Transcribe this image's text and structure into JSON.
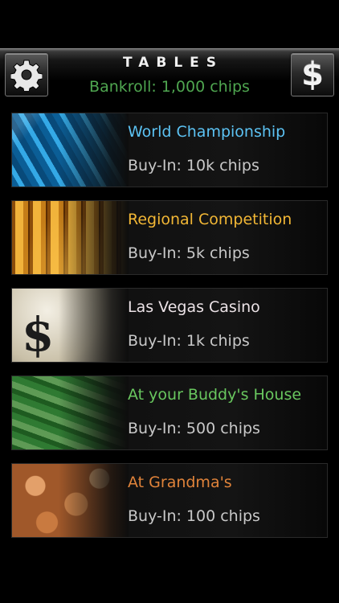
{
  "header": {
    "title": "TABLES",
    "bankroll": "Bankroll: 1,000 chips",
    "settings_icon": "gear-icon",
    "store_icon": "dollar-icon",
    "store_label": "$"
  },
  "tables": [
    {
      "name": "World Championship",
      "buyin": "Buy-In: 10k chips",
      "color": "#5cc3f4"
    },
    {
      "name": "Regional Competition",
      "buyin": "Buy-In: 5k chips",
      "color": "#f2b735"
    },
    {
      "name": "Las Vegas Casino",
      "buyin": "Buy-In: 1k chips",
      "color": "#ebe2e6"
    },
    {
      "name": "At your Buddy's House",
      "buyin": "Buy-In: 500 chips",
      "color": "#69c75f"
    },
    {
      "name": "At Grandma's",
      "buyin": "Buy-In: 100 chips",
      "color": "#e0833a"
    }
  ],
  "colors": {
    "bankroll": "#4fa650",
    "background": "#000000"
  }
}
